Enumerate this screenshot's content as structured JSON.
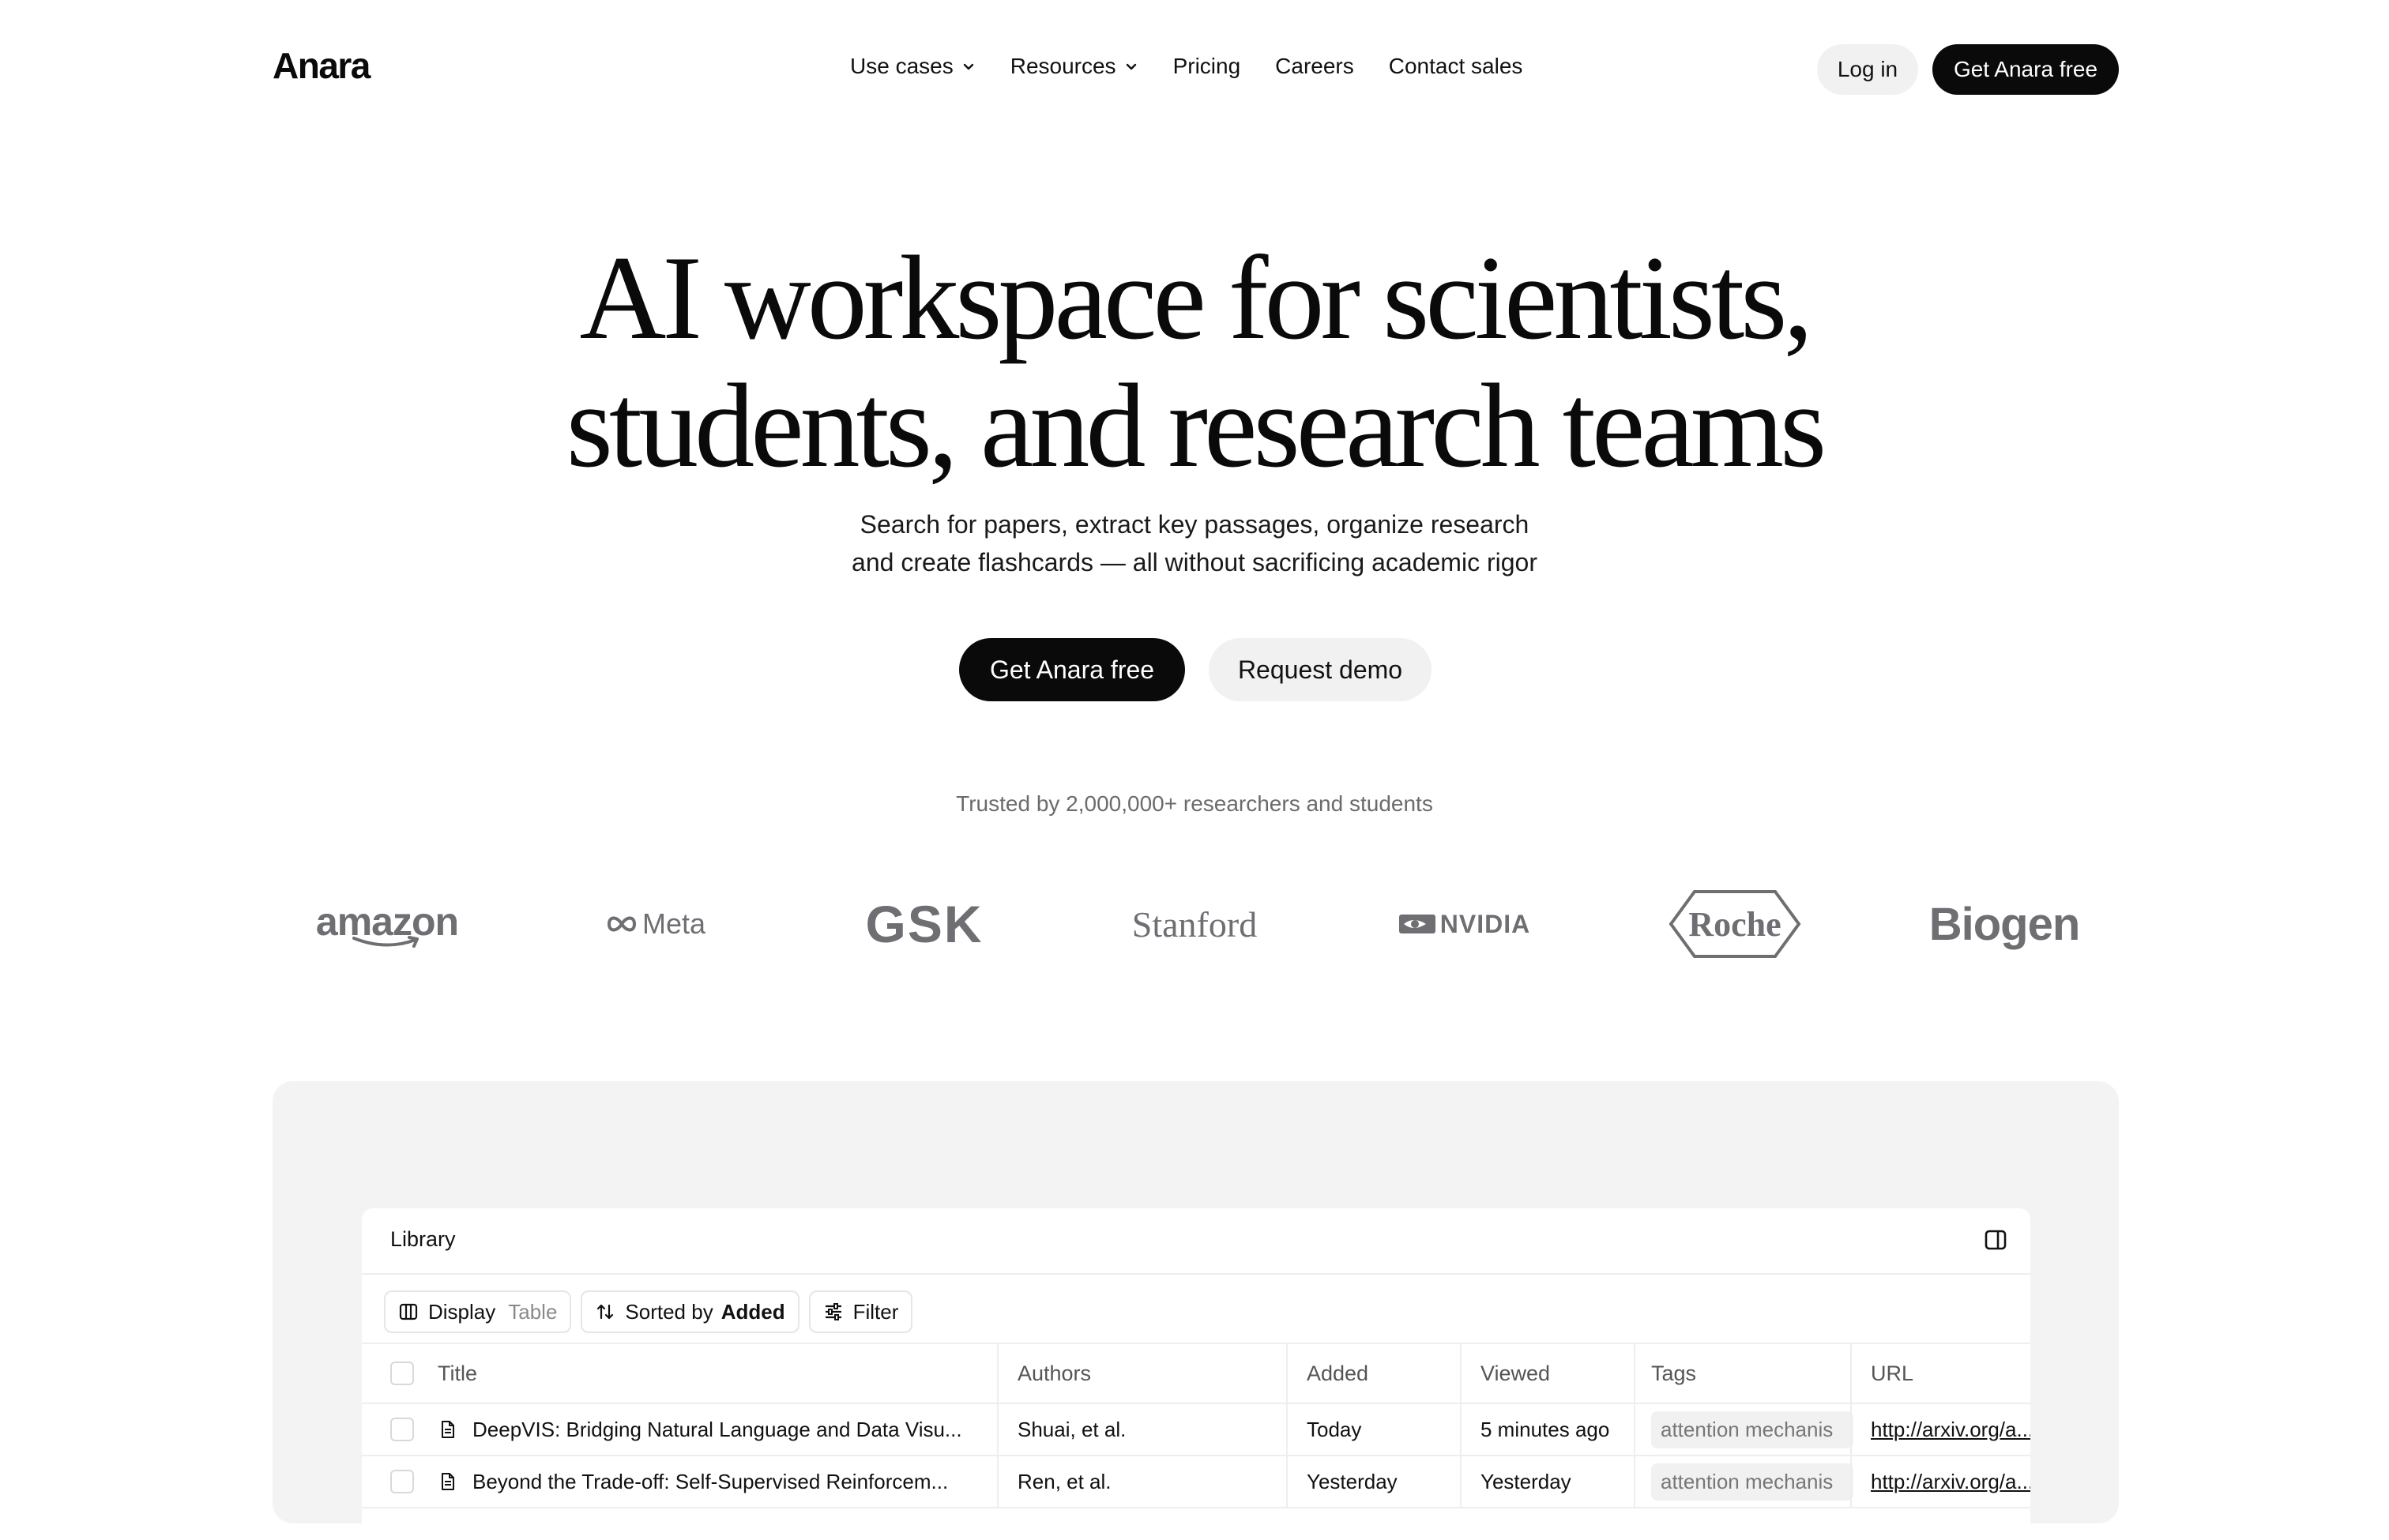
{
  "nav": {
    "logo": "Anara",
    "menu": [
      {
        "label": "Use cases",
        "dropdown": true
      },
      {
        "label": "Resources",
        "dropdown": true
      },
      {
        "label": "Pricing",
        "dropdown": false
      },
      {
        "label": "Careers",
        "dropdown": false
      },
      {
        "label": "Contact sales",
        "dropdown": false
      }
    ],
    "login_label": "Log in",
    "cta_label": "Get Anara free"
  },
  "hero": {
    "title_line1": "AI workspace for scientists,",
    "title_line2": "students, and research teams",
    "subtitle_line1": "Search for papers, extract key passages, organize research",
    "subtitle_line2": "and create flashcards — all without sacrificing academic rigor",
    "primary_label": "Get Anara free",
    "secondary_label": "Request demo",
    "trusted": "Trusted by 2,000,000+ researchers and students"
  },
  "logos": {
    "amazon": "amazon",
    "meta": "Meta",
    "gsk": "GSK",
    "stanford": "Stanford",
    "nvidia": "NVIDIA",
    "roche": "Roche",
    "biogen": "Biogen"
  },
  "library": {
    "title": "Library",
    "toolbar": {
      "display_label": "Display",
      "display_value": "Table",
      "sort_label": "Sorted by",
      "sort_value": "Added",
      "filter_label": "Filter"
    },
    "columns": {
      "title": "Title",
      "authors": "Authors",
      "added": "Added",
      "viewed": "Viewed",
      "tags": "Tags",
      "url": "URL"
    },
    "rows": [
      {
        "title": "DeepVIS: Bridging Natural Language and Data Visu...",
        "authors": "Shuai, et al.",
        "added": "Today",
        "viewed": "5 minutes ago",
        "tag": "attention mechanis",
        "url": "http://arxiv.org/a..."
      },
      {
        "title": "Beyond the Trade-off: Self-Supervised Reinforcem...",
        "authors": "Ren, et al.",
        "added": "Yesterday",
        "viewed": "Yesterday",
        "tag": "attention mechanis",
        "url": "http://arxiv.org/a..."
      }
    ]
  },
  "colors": {
    "brand_dark": "#0a0a0a",
    "pill_light": "#f1f1f1",
    "logo_gray": "#6e6e73",
    "panel_bg": "#f3f3f3"
  }
}
